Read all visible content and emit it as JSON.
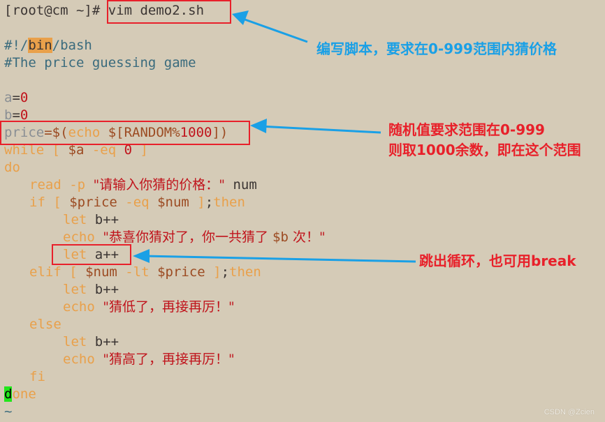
{
  "terminal": {
    "prompt": "[root@cm ~]#",
    "command": "vim demo2.sh",
    "lines": {
      "shebang_pre": "#!/",
      "shebang_bin": "bin",
      "shebang_post": "/bash",
      "comment": "#The price guessing game",
      "a_var": "a",
      "b_var": "b",
      "eq": "=",
      "zero": "0",
      "price_var": "price",
      "price_eq": "=$(",
      "echo_kw": "echo",
      "random_expr": " $[RANDOM%",
      "random_mod": "1000",
      "random_close": "])",
      "while_kw": "while",
      "while_open": " [ ",
      "while_var": "$a",
      "while_op": " -eq ",
      "while_val": "0",
      "while_close": " ]",
      "do_kw": "do",
      "read_kw": "read",
      "read_opt": " -p ",
      "read_prompt": "\"请输入你猜的价格：\"",
      "read_var": " num",
      "if_kw": "if",
      "if_open": " [ ",
      "if_var1": "$price",
      "if_op": " -eq ",
      "if_var2": "$num",
      "if_close": " ]",
      "semicolon": ";",
      "then_kw": "then",
      "let_kw": "let",
      "b_inc": " b++",
      "a_inc": " a++",
      "echo_win_open": "\"",
      "echo_win_text": "恭喜你猜对了，你一共猜了 ",
      "echo_win_var": "$b",
      "echo_win_tail": " 次！",
      "echo_win_close": "\"",
      "elif_kw": "elif",
      "elif_open": " [ ",
      "elif_var1": "$num",
      "elif_op": " -lt ",
      "elif_var2": "$price",
      "elif_close": " ]",
      "echo_low": "\"猜低了，再接再厉！\"",
      "else_kw": "else",
      "echo_high": "\"猜高了，再接再厉！\"",
      "fi_kw": "fi",
      "done_cursor": "d",
      "done_rest": "one",
      "tilde": "~"
    }
  },
  "annotations": {
    "note1": "编写脚本，要求在0-999范围内猜价格",
    "note2_line1": "随机值要求范围在0-999",
    "note2_line2": "则取1000余数，即在这个范围",
    "note3": "跳出循环，也可用break"
  },
  "watermark": "CSDN @Zcien",
  "colors": {
    "annotation_blue": "#1aa0e6",
    "annotation_red": "#e8202a",
    "background": "#d5cbb7"
  }
}
